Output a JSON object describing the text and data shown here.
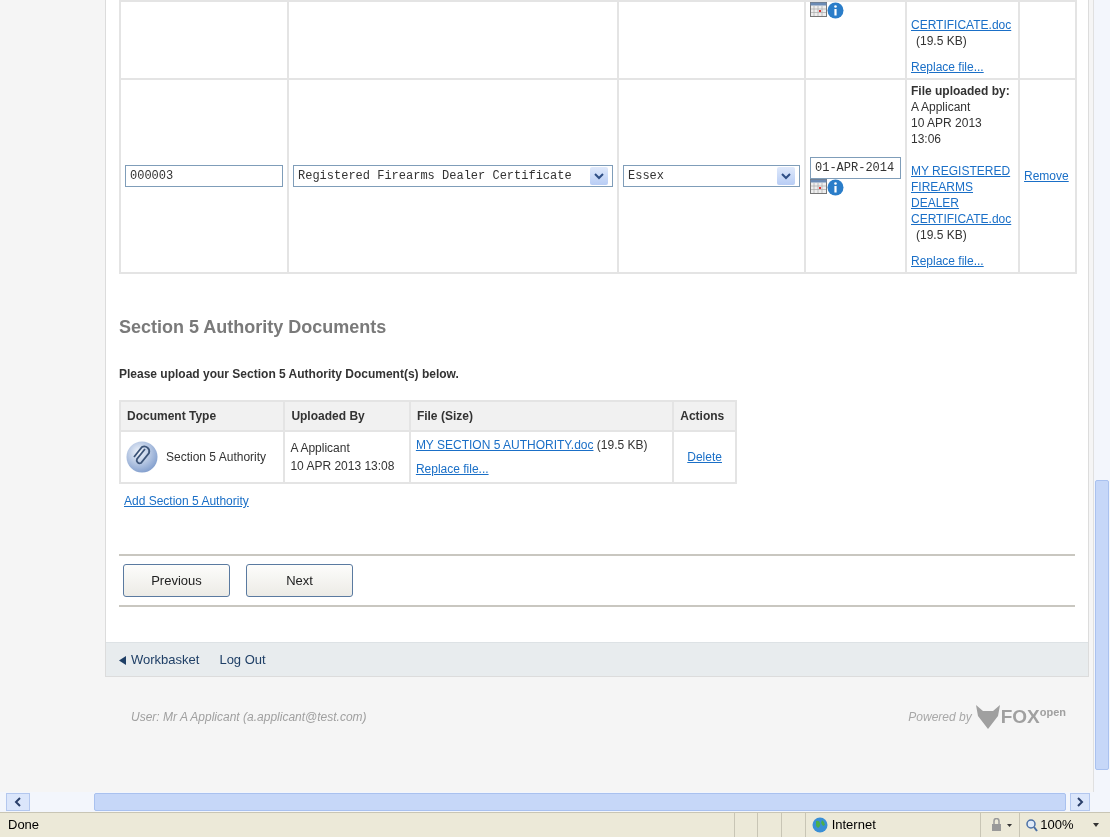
{
  "documents_table": {
    "rows": [
      {
        "kind": "partial",
        "file_link": "CERTIFICATE.doc",
        "file_size": "(19.5 KB)",
        "replace_link": "Replace file..."
      },
      {
        "kind": "full",
        "reference": "000003",
        "document_type": "Registered Firearms Dealer Certificate",
        "issuing_area": "Essex",
        "expiry_date": "01-APR-2014",
        "uploaded_by_label": "File uploaded by:",
        "uploaded_by": "A Applicant",
        "uploaded_date": "10 APR 2013",
        "uploaded_time": "13:06",
        "file_link": "MY REGISTERED FIREARMS DEALER CERTIFICATE.doc",
        "file_size": "(19.5 KB)",
        "replace_link": "Replace file...",
        "action": "Remove"
      }
    ]
  },
  "section5": {
    "title": "Section 5 Authority Documents",
    "instruction": "Please upload your Section 5 Authority Document(s) below.",
    "columns": [
      "Document Type",
      "Uploaded By",
      "File (Size)",
      "Actions"
    ],
    "rows": [
      {
        "document_type": "Section 5 Authority",
        "uploaded_by": "A Applicant",
        "uploaded_at": "10 APR 2013 13:08",
        "file_link": "MY SECTION 5 AUTHORITY.doc",
        "file_size": "(19.5 KB)",
        "replace_link": "Replace file...",
        "action": "Delete"
      }
    ],
    "add_link": "Add Section 5 Authority"
  },
  "buttons": [
    "Previous",
    "Next"
  ],
  "footer_nav": [
    {
      "label": "Workbasket",
      "kind": "back"
    },
    {
      "label": "Log Out",
      "kind": "plain"
    }
  ],
  "user_info": "User: Mr A Applicant (a.applicant@test.com)",
  "powered_by": {
    "label": "Powered by",
    "brand": "FOX",
    "brand_suffix": "open"
  },
  "status_bar": {
    "text": "Done",
    "zone": "Internet",
    "zoom": "100%"
  }
}
